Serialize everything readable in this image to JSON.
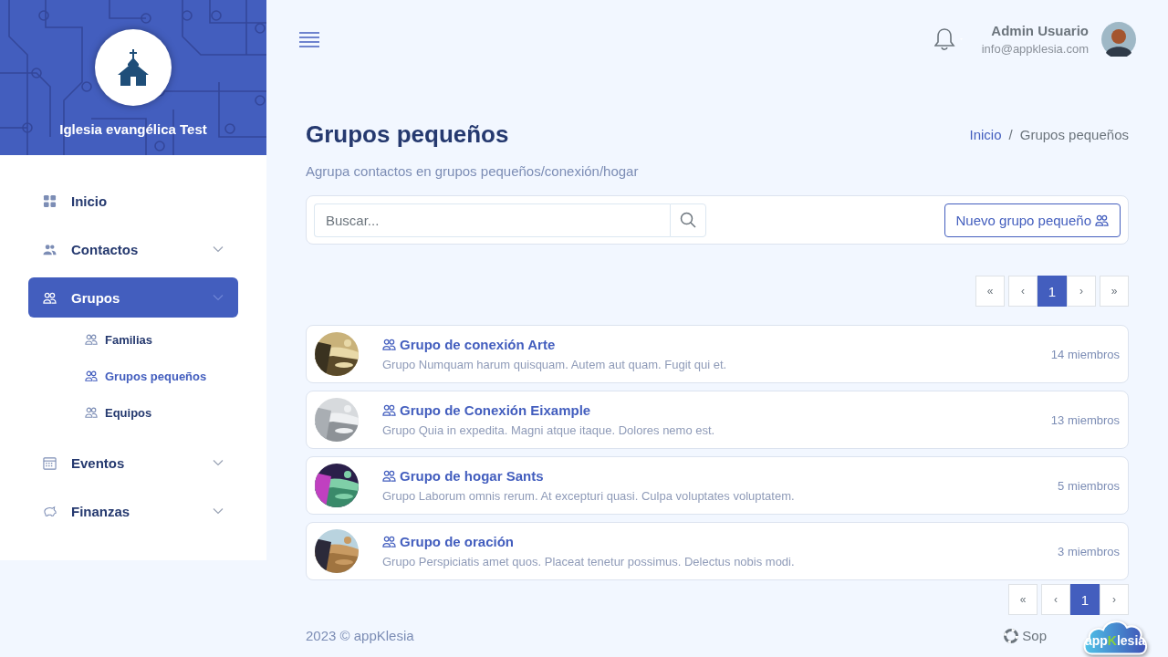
{
  "sidebar": {
    "org_name": "Iglesia evangélica Test",
    "items": [
      {
        "label": "Inicio",
        "kind": "link",
        "selected": false
      },
      {
        "label": "Contactos",
        "kind": "menu",
        "selected": false
      },
      {
        "label": "Grupos",
        "kind": "menu",
        "selected": true,
        "children": [
          {
            "label": "Familias",
            "selected": false
          },
          {
            "label": "Grupos pequeños",
            "selected": true
          },
          {
            "label": "Equipos",
            "selected": false
          }
        ]
      },
      {
        "label": "Eventos",
        "kind": "menu",
        "selected": false
      },
      {
        "label": "Finanzas",
        "kind": "menu",
        "selected": false
      }
    ]
  },
  "topbar": {
    "user_name": "Admin Usuario",
    "user_email": "info@appklesia.com"
  },
  "page": {
    "title": "Grupos pequeños",
    "subtitle": "Agrupa contactos en grupos pequeños/conexión/hogar",
    "breadcrumb": [
      {
        "label": "Inicio",
        "kind": "link"
      },
      {
        "label": "/",
        "kind": "separator"
      },
      {
        "label": "Grupos pequeños",
        "kind": "current"
      }
    ]
  },
  "search": {
    "placeholder": "Buscar..."
  },
  "new_button": "Nuevo grupo pequeño",
  "pagination_top": [
    {
      "label": "«",
      "selected": false
    },
    {
      "label": "‹",
      "selected": false
    },
    {
      "label": "1",
      "selected": true
    },
    {
      "label": "›",
      "selected": false
    },
    {
      "label": "»",
      "selected": false
    }
  ],
  "groups": [
    {
      "name": "Grupo de conexión Arte",
      "description": "Grupo Numquam harum quisquam. Autem aut quam. Fugit qui et.",
      "members": "14 miembros",
      "kind": "picture"
    },
    {
      "name": "Grupo de Conexión Eixample",
      "description": "Grupo Quia in expedita. Magni atque itaque. Dolores nemo est.",
      "members": "13 miembros",
      "kind": "picture"
    },
    {
      "name": "Grupo de hogar Sants",
      "description": "Grupo Laborum omnis rerum. At excepturi quasi. Culpa voluptates voluptatem.",
      "members": "5 miembros",
      "kind": "picture"
    },
    {
      "name": "Grupo de oración",
      "description": "Grupo Perspiciatis amet quos. Placeat tenetur possimus. Delectus nobis modi.",
      "members": "3 miembros",
      "kind": "picture"
    }
  ],
  "pagination_bottom": [
    {
      "label": "«",
      "selected": false
    },
    {
      "label": "‹",
      "selected": false
    },
    {
      "label": "1",
      "selected": true
    },
    {
      "label": "›",
      "selected": false
    }
  ],
  "footer": {
    "copyright": "2023 © appKlesia",
    "support": "Sop"
  },
  "widget": {
    "parts": [
      "app",
      "K",
      "lesia"
    ]
  }
}
